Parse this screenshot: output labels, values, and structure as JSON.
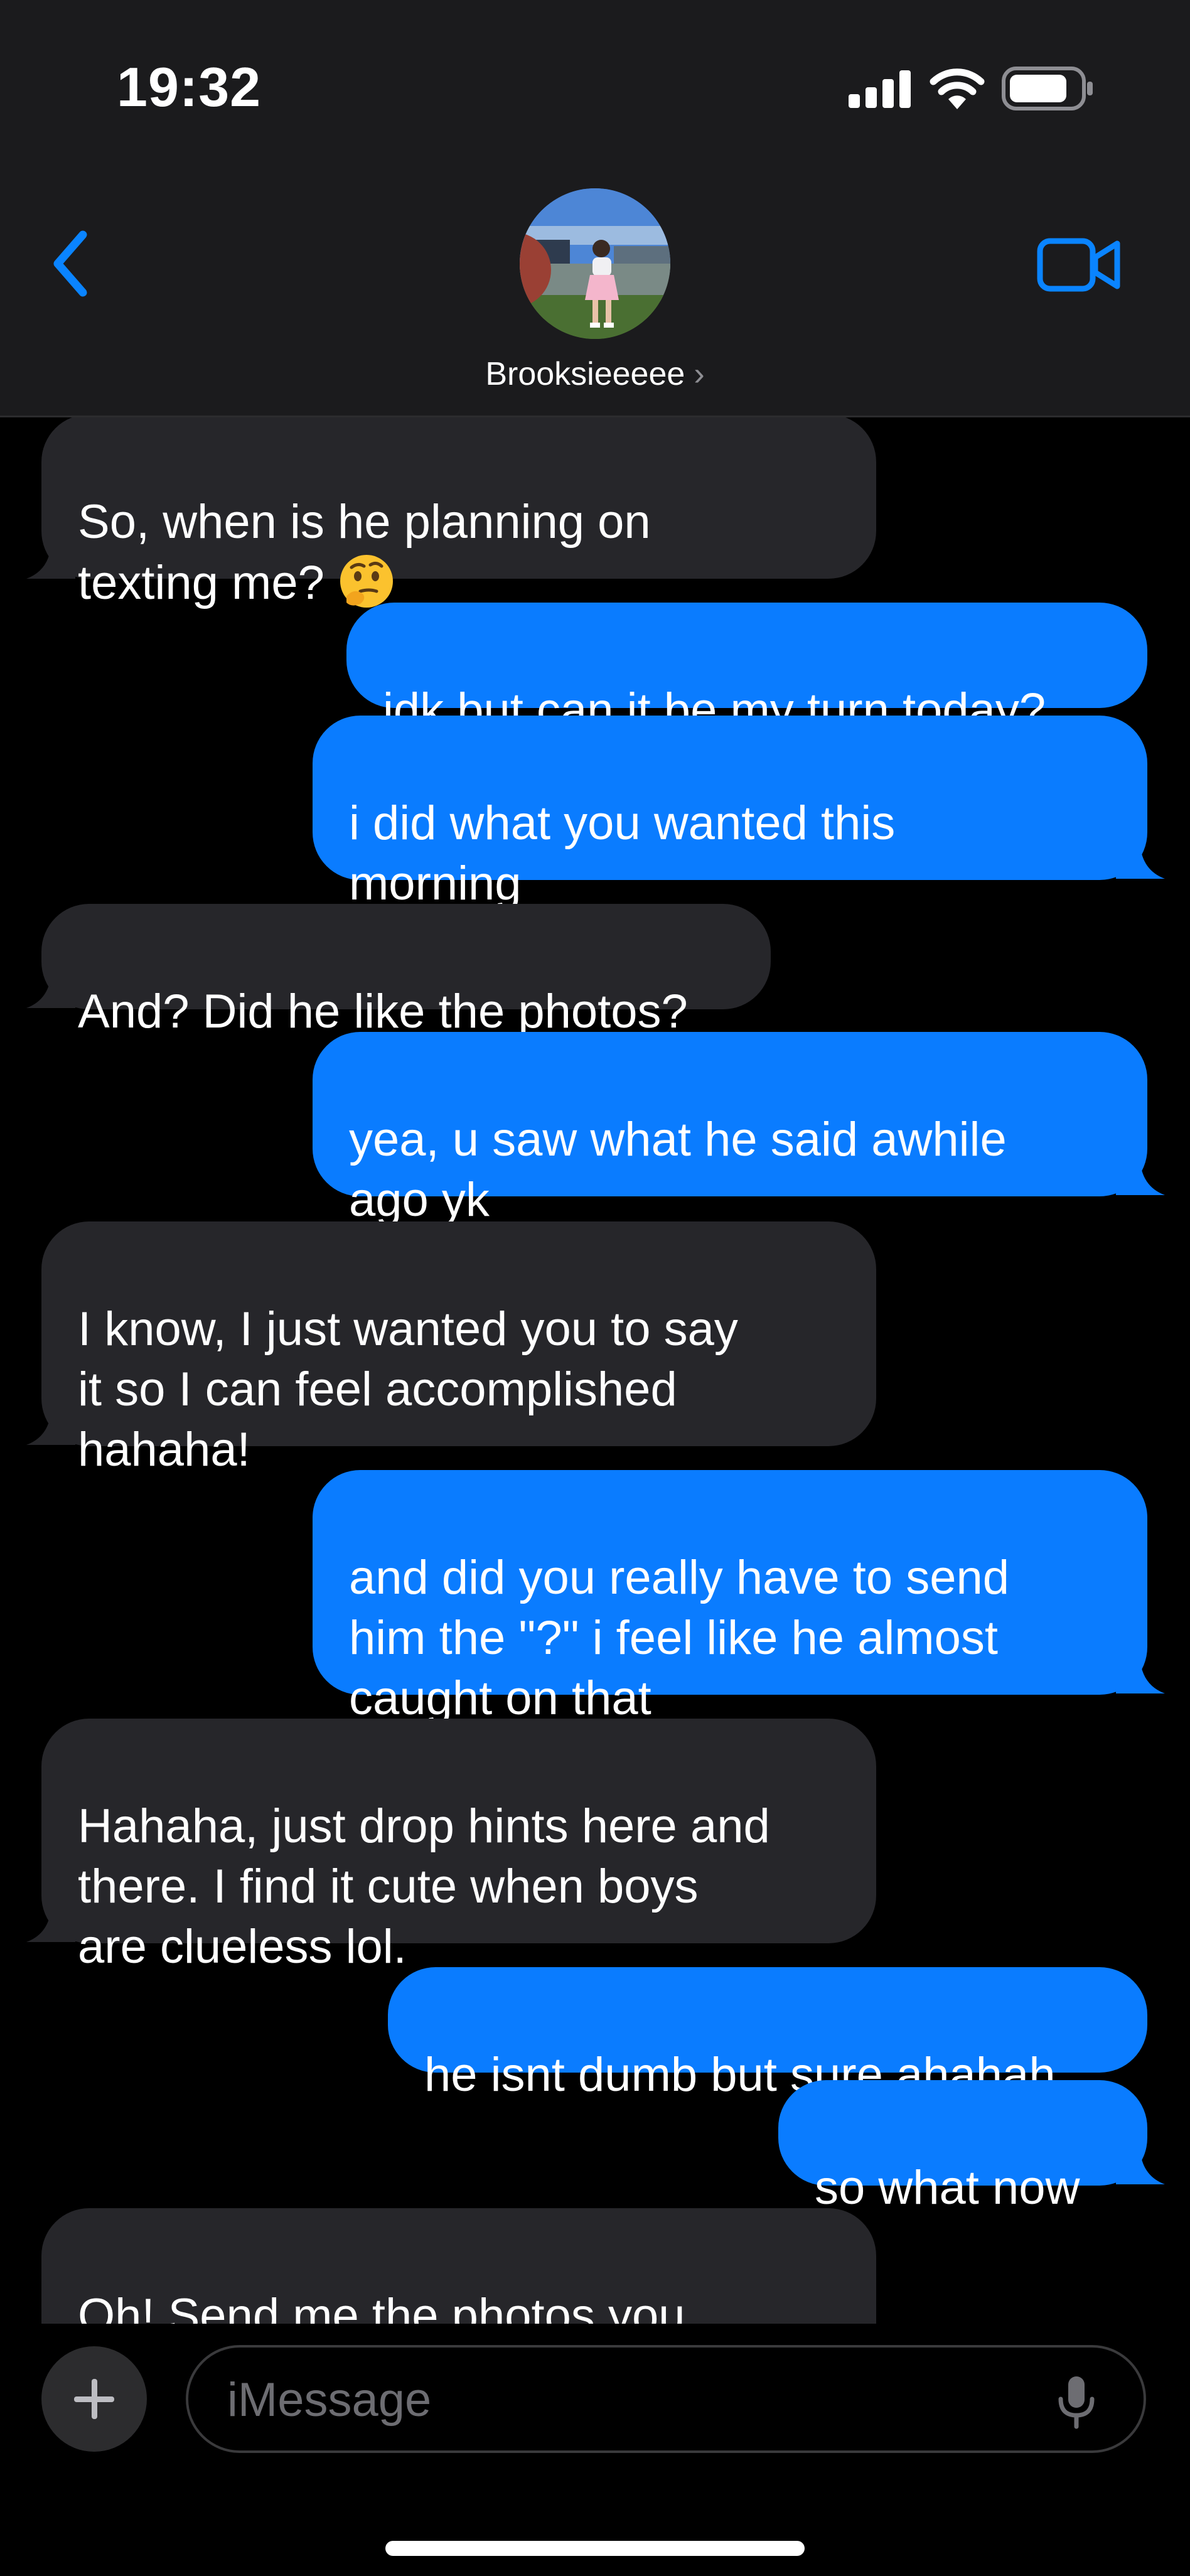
{
  "status_bar": {
    "time": "19:32"
  },
  "header": {
    "contact_name": "Brooksieeeee",
    "name_chevron": "›",
    "icons": [
      "back-chevron-icon",
      "contact-avatar",
      "video-call-icon"
    ]
  },
  "messages": [
    {
      "from": "them",
      "text": "So, when is he planning on\ntexting me? ",
      "emoji": "thinking-face"
    },
    {
      "from": "me",
      "text": "idk but can it be my turn today?"
    },
    {
      "from": "me",
      "text": "i did what you wanted this\nmorning"
    },
    {
      "from": "them",
      "text": "And? Did he like the photos?"
    },
    {
      "from": "me",
      "text": "yea, u saw what he said awhile\nago yk"
    },
    {
      "from": "them",
      "text": "I know, I just wanted you to say\nit so I can feel accomplished\nhahaha!"
    },
    {
      "from": "me",
      "text": "and did you really have to send\nhim the \"?\" i feel like he almost\ncaught on that"
    },
    {
      "from": "them",
      "text": "Hahaha, just drop hints here and\nthere. I find it cute when boys\nare clueless lol."
    },
    {
      "from": "me",
      "text": "he isnt dumb but sure ahahah"
    },
    {
      "from": "me",
      "text": "so what now"
    },
    {
      "from": "them",
      "text": "Oh! Send me the photos you\ntook of me awhile ago, ugh hate"
    }
  ],
  "composer": {
    "placeholder": "iMessage",
    "value": ""
  },
  "colors": {
    "sent_bubble": "#0a7cff",
    "received_bubble": "#26262a",
    "accent": "#0a84ff",
    "header_bg": "#1b1b1d"
  }
}
